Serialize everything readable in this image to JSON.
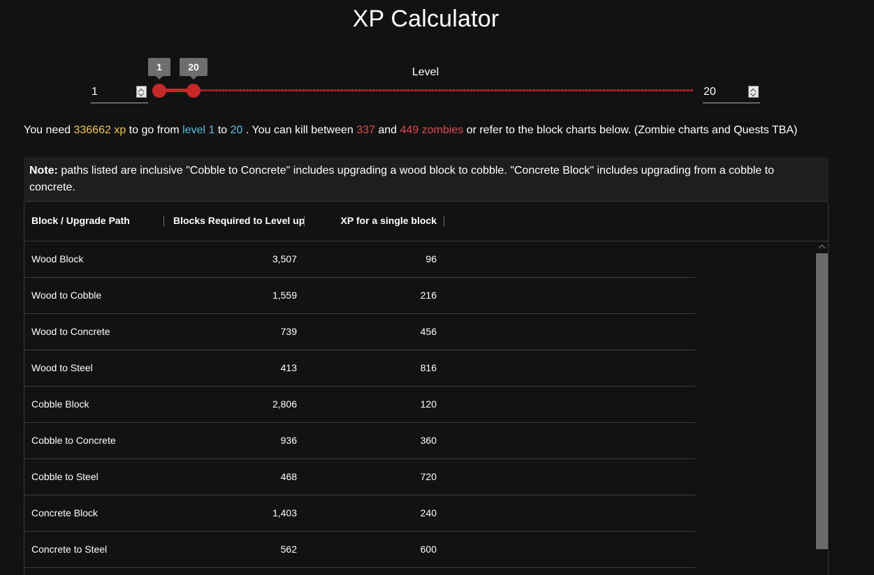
{
  "title": "XP Calculator",
  "slider": {
    "label": "Level",
    "min_value": "1",
    "max_value": "20",
    "min_tooltip": "1",
    "max_tooltip": "20",
    "accent_color": "#c62828"
  },
  "summary": {
    "p1": "You need ",
    "xp_value": "336662",
    "xp_unit": " xp",
    "p2": " to go from ",
    "from_level": "level 1",
    "p3": " to ",
    "to_level": "20",
    "p4": " . You can kill between ",
    "zombies_min": "337",
    "p5": " and ",
    "zombies_max": "449 zombies",
    "p6": " or refer to the block charts below. (Zombie charts and Quests TBA)"
  },
  "note": {
    "label": "Note:",
    "text": " paths listed are inclusive \"Cobble to Concrete\" includes upgrading a wood block to cobble. \"Concrete Block\" includes upgrading from a cobble to concrete."
  },
  "table": {
    "headers": [
      "Block / Upgrade Path",
      "Blocks Required to Level up",
      "XP for a single block"
    ],
    "rows": [
      {
        "path": "Wood Block",
        "blocks": "3,507",
        "xp": "96"
      },
      {
        "path": "Wood to Cobble",
        "blocks": "1,559",
        "xp": "216"
      },
      {
        "path": "Wood to Concrete",
        "blocks": "739",
        "xp": "456"
      },
      {
        "path": "Wood to Steel",
        "blocks": "413",
        "xp": "816"
      },
      {
        "path": "Cobble Block",
        "blocks": "2,806",
        "xp": "120"
      },
      {
        "path": "Cobble to Concrete",
        "blocks": "936",
        "xp": "360"
      },
      {
        "path": "Cobble to Steel",
        "blocks": "468",
        "xp": "720"
      },
      {
        "path": "Concrete Block",
        "blocks": "1,403",
        "xp": "240"
      },
      {
        "path": "Concrete to Steel",
        "blocks": "562",
        "xp": "600"
      }
    ]
  },
  "colors": {
    "xp": "#f2c94c",
    "level": "#5bc0de",
    "zombies": "#e24b4b",
    "background": "#121212"
  }
}
